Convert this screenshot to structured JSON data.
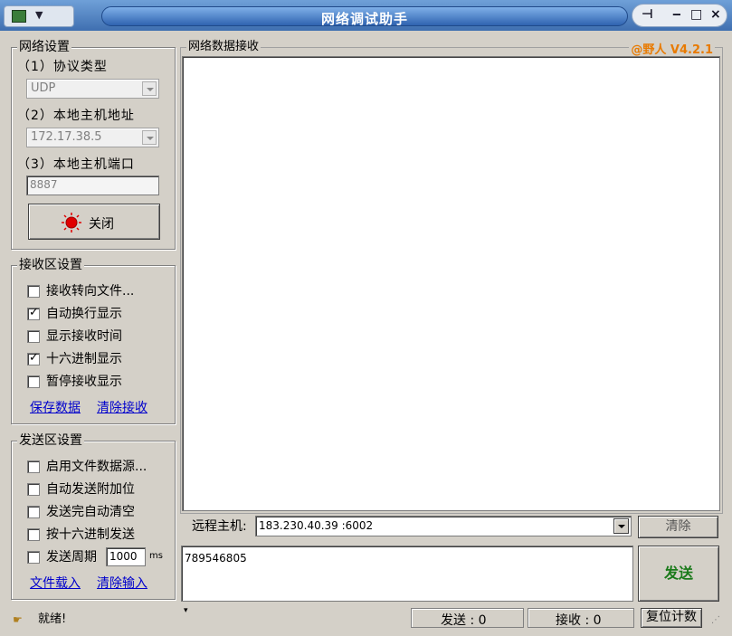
{
  "window": {
    "title": "网络调试助手",
    "version": "@野人 V4.2.1",
    "accent": "#e87a00"
  },
  "title_buttons": {
    "pin": "⊣",
    "minimize": "‒",
    "restore": "□",
    "close": "×"
  },
  "network": {
    "group_title": "网络设置",
    "protocol_label": "（1）协议类型",
    "protocol_value": "UDP",
    "host_label": "（2）本地主机地址",
    "host_value": "172.17.38.5",
    "port_label": "（3）本地主机端口",
    "port_value": "8887",
    "toggle_button": "关闭"
  },
  "receive": {
    "group_title": "接收区设置",
    "options": [
      {
        "label": "接收转向文件...",
        "checked": false
      },
      {
        "label": "自动换行显示",
        "checked": true
      },
      {
        "label": "显示接收时间",
        "checked": false
      },
      {
        "label": "十六进制显示",
        "checked": true
      },
      {
        "label": "暂停接收显示",
        "checked": false
      }
    ],
    "save_link": "保存数据",
    "clear_link": "清除接收"
  },
  "send": {
    "group_title": "发送区设置",
    "options": [
      {
        "label": "启用文件数据源...",
        "checked": false
      },
      {
        "label": "自动发送附加位",
        "checked": false
      },
      {
        "label": "发送完自动清空",
        "checked": false
      },
      {
        "label": "按十六进制发送",
        "checked": false
      }
    ],
    "period_label": "发送周期",
    "period_value": "1000",
    "period_unit": "ms",
    "load_link": "文件载入",
    "clear_link": "清除输入"
  },
  "receive_area": {
    "title": "网络数据接收"
  },
  "remote": {
    "label": "远程主机:",
    "value": "183.230.40.39 :6002",
    "clear_button": "清除"
  },
  "send_area": {
    "text": "789546805",
    "send_button": "发送",
    "send_color": "#1a7a1a"
  },
  "status": {
    "ready": "就绪!",
    "sent_label": "发送 : 0",
    "recv_label": "接收 : 0",
    "reset_button": "复位计数"
  }
}
